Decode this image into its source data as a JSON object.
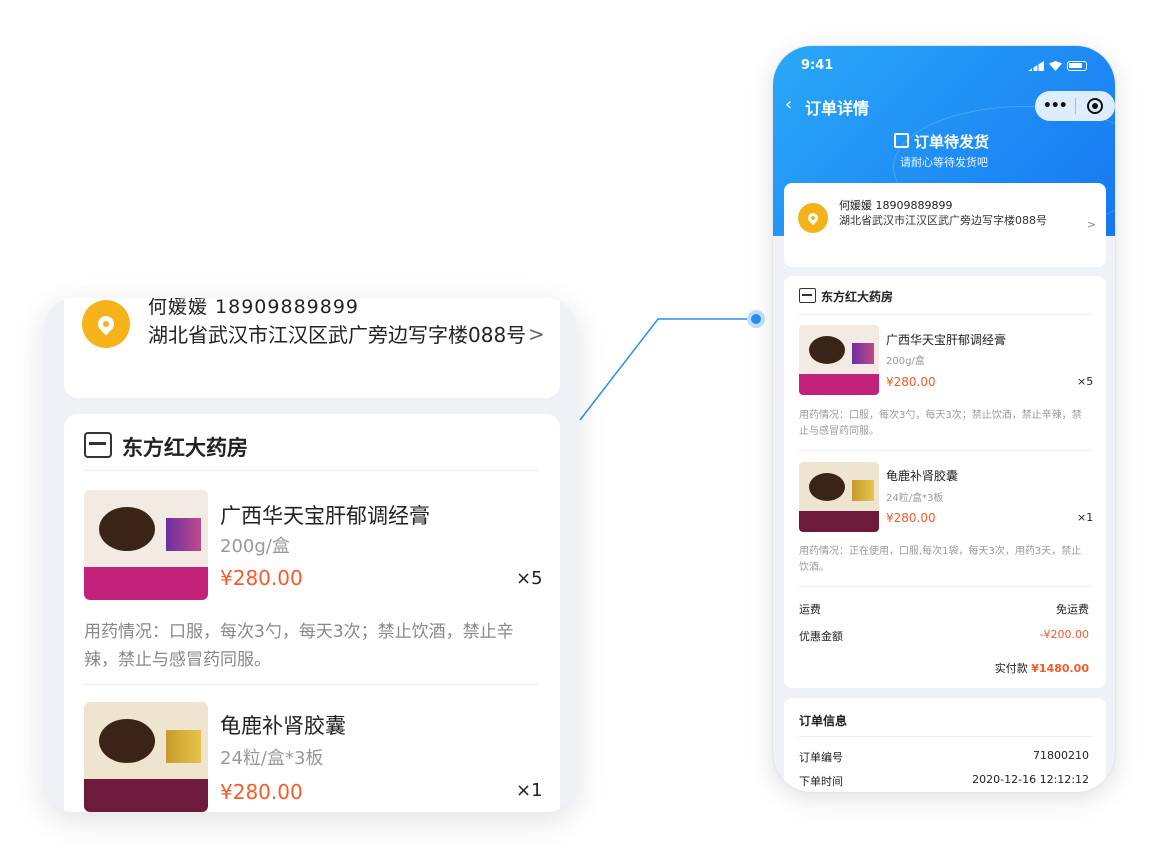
{
  "phone": {
    "status_time": "9:41",
    "nav_title": "订单详情",
    "back_icon": "chevron-left-icon",
    "capsule_more": "•••",
    "order_status": "订单待发货",
    "order_status_sub": "请耐心等待发货吧",
    "address": {
      "name_phone": "何媛媛  18909889899",
      "street": "湖北省武汉市江汉区武广旁边写字楼088号",
      "arrow": ">"
    },
    "shop_name": "东方红大药房",
    "products": [
      {
        "title": "广西华天宝肝郁调经膏",
        "spec": "200g/盒",
        "price": "¥280.00",
        "qty": "×5",
        "usage": "用药情况：口服，每次3勺，每天3次；禁止饮酒，禁止辛辣，禁止与感冒药同服。"
      },
      {
        "title": "龟鹿补肾胶囊",
        "spec": "24粒/盒*3板",
        "price": "¥280.00",
        "qty": "×1",
        "usage": "用药情况：正在使用，口服,每次1袋，每天3次，用药3天，禁止饮酒。"
      }
    ],
    "shipping_label": "运费",
    "shipping_value": "免运费",
    "discount_label": "优惠金额",
    "discount_value": "-¥200.00",
    "paid_label": "实付款",
    "paid_value": "¥1480.00",
    "info_title": "订单信息",
    "order_no_label": "订单编号",
    "order_no_value": "71800210",
    "order_time_label": "下单时间",
    "order_time_value": "2020-12-16  12:12:12"
  },
  "zoom": {
    "name_phone": "何媛媛  18909889899",
    "street": "湖北省武汉市江汉区武广旁边写字楼088号",
    "arrow": ">",
    "shop_name": "东方红大药房",
    "products": [
      {
        "title": "广西华天宝肝郁调经膏",
        "spec": "200g/盒",
        "price": "¥280.00",
        "qty": "×5",
        "usage": "用药情况：口服，每次3勺，每天3次；禁止饮酒，禁止辛辣，禁止与感冒药同服。"
      },
      {
        "title": "龟鹿补肾胶囊",
        "spec": "24粒/盒*3板",
        "price": "¥280.00",
        "qty": "×1"
      }
    ]
  },
  "colors": {
    "header_blue": "#1a8cf5",
    "price_orange": "#fa5a2a",
    "pin_yellow": "#f6b21b",
    "product1_bg": "#c3227a",
    "product2_bg": "#6e1a3a"
  }
}
